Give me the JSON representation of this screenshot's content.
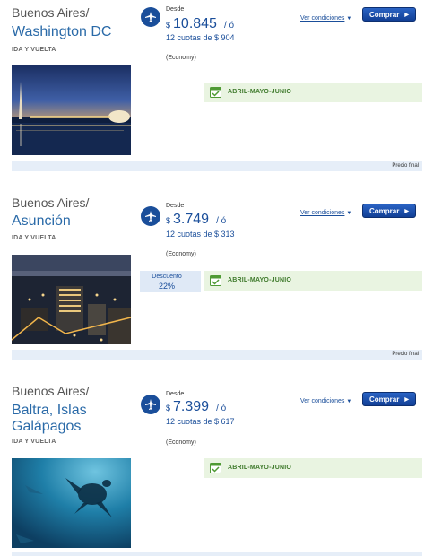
{
  "labels": {
    "desde": "Desde",
    "currency": "$",
    "slash": "/ ó",
    "conditions": "Ver condiciones",
    "buy": "Comprar",
    "final_price": "Precio final",
    "trip_type": "IDA Y VUELTA"
  },
  "offers": [
    {
      "origin": "Buenos Aires/",
      "destination": "Washington DC",
      "price": "10.845",
      "installments": "12 cuotas de $ 904",
      "cabin": "(Economy)",
      "season": "ABRIL-MAYO-JUNIO",
      "photo_icon": "washington-night-photo"
    },
    {
      "origin": "Buenos Aires/",
      "destination": "Asunción",
      "price": "3.749",
      "installments": "12 cuotas de $ 313",
      "cabin": "(Economy)",
      "season": "ABRIL-MAYO-JUNIO",
      "discount_label": "Descuento",
      "discount_value": "22%",
      "photo_icon": "asuncion-city-photo"
    },
    {
      "origin": "Buenos Aires/",
      "destination": "Baltra, Islas Galápagos",
      "price": "7.399",
      "installments": "12 cuotas de $ 617",
      "cabin": "(Economy)",
      "season": "ABRIL-MAYO-JUNIO",
      "photo_icon": "sea-turtle-photo"
    }
  ],
  "colors": {
    "brand": "#1a4e9a",
    "link": "#2a6aa8",
    "season_bg": "#e9f4e1",
    "season_text": "#3f7a2c",
    "bar_bg": "#e6eef8"
  }
}
